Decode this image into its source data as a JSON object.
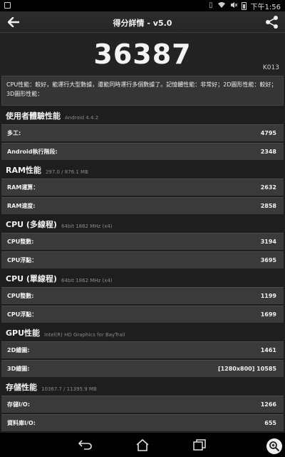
{
  "status_bar": {
    "time": "下午1:56"
  },
  "header": {
    "title": "得分詳情 - v5.0"
  },
  "score": {
    "total": "36387",
    "model": "K013"
  },
  "summary": "CPU性能：較好，能運行大型數據，還能同時運行多個數據了。記憶體性能：非常好；2D圖形性能：較好；3D圖形性能：",
  "sections": [
    {
      "title": "使用者體驗性能",
      "subtitle": "Android 4.4.2",
      "items": [
        {
          "label": "多工:",
          "value": "4795"
        },
        {
          "label": "Android執行階段:",
          "value": "2348"
        }
      ]
    },
    {
      "title": "RAM性能",
      "subtitle": "297.0 / 876.1 MB",
      "items": [
        {
          "label": "RAM運算：",
          "value": "2632"
        },
        {
          "label": "RAM速度:",
          "value": "2858"
        }
      ]
    },
    {
      "title": "CPU (多線程)",
      "subtitle": "64bit 1862 MHz (x4)",
      "items": [
        {
          "label": "CPU整數:",
          "value": "3194"
        },
        {
          "label": "CPU浮點：",
          "value": "3695"
        }
      ]
    },
    {
      "title": "CPU (單線程)",
      "subtitle": "64bit 1862 MHz (x4)",
      "items": [
        {
          "label": "CPU整數:",
          "value": "1199"
        },
        {
          "label": "CPU浮點：",
          "value": "1699"
        }
      ]
    },
    {
      "title": "GPU性能",
      "subtitle": "Intel(R) HD Graphics for BayTrail",
      "items": [
        {
          "label": "2D繪圖:",
          "value": "1461"
        },
        {
          "label": "3D繪圖:",
          "value": "[1280x800] 10585"
        }
      ]
    },
    {
      "title": "存儲性能",
      "subtitle": "10367.7 / 11395.9 MB",
      "items": [
        {
          "label": "存儲I/O:",
          "value": "1266"
        },
        {
          "label": "資料庫I/O:",
          "value": "655"
        }
      ]
    }
  ]
}
